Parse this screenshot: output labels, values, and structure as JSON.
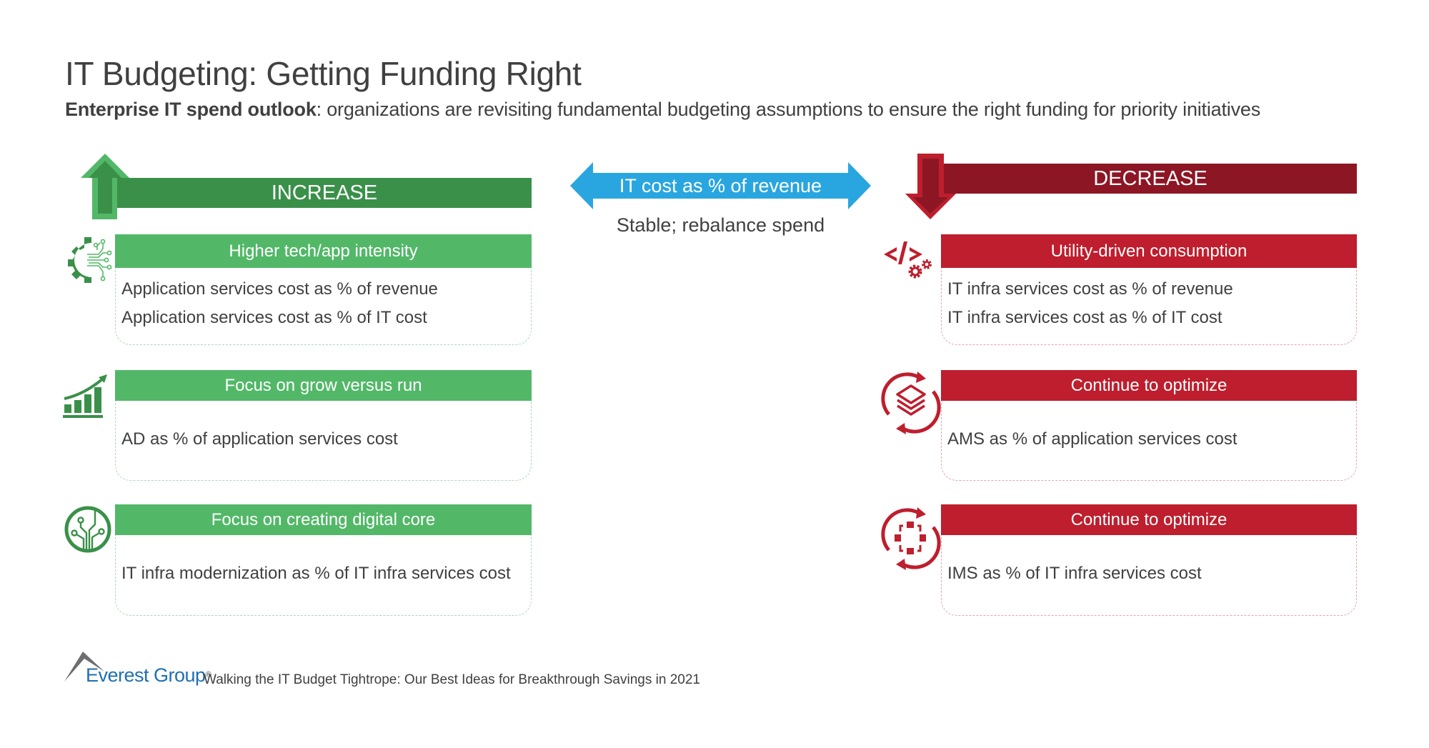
{
  "title": "IT Budgeting: Getting Funding Right",
  "subtitle": {
    "bold": "Enterprise IT spend outlook",
    "rest": ": organizations are revisiting fundamental budgeting assumptions to ensure the right funding for priority initiatives"
  },
  "increase": {
    "label": "INCREASE",
    "color_dark": "#3a9049",
    "color_light": "#52b868",
    "items": [
      {
        "icon": "gear-circuit-icon",
        "heading": "Higher tech/app intensity",
        "lines": [
          "Application services cost as % of revenue",
          "Application services cost as % of IT cost"
        ]
      },
      {
        "icon": "growth-chart-icon",
        "heading": "Focus on grow versus run",
        "lines": [
          "AD as % of application services cost"
        ]
      },
      {
        "icon": "digital-core-circuit-icon",
        "heading": "Focus on creating digital core",
        "lines": [
          "IT infra modernization as % of IT infra services cost"
        ]
      }
    ]
  },
  "center": {
    "arrow_label": "IT cost as % of revenue",
    "note": "Stable; rebalance spend",
    "color": "#29a6df"
  },
  "decrease": {
    "label": "DECREASE",
    "color_dark": "#8d1624",
    "color_light": "#be1e2d",
    "items": [
      {
        "icon": "code-gears-icon",
        "heading": "Utility-driven consumption",
        "lines": [
          "IT infra services cost as % of revenue",
          "IT infra services cost as % of IT cost"
        ]
      },
      {
        "icon": "refresh-layers-icon",
        "heading": "Continue to optimize",
        "lines": [
          "AMS as % of application services cost"
        ]
      },
      {
        "icon": "refresh-network-icon",
        "heading": "Continue to optimize",
        "lines": [
          "IMS as % of IT infra services cost"
        ]
      }
    ]
  },
  "footer": {
    "brand": "Everest Group",
    "registered": "®",
    "tagline": "Walking the IT Budget Tightrope: Our Best Ideas for Breakthrough Savings in 2021"
  }
}
